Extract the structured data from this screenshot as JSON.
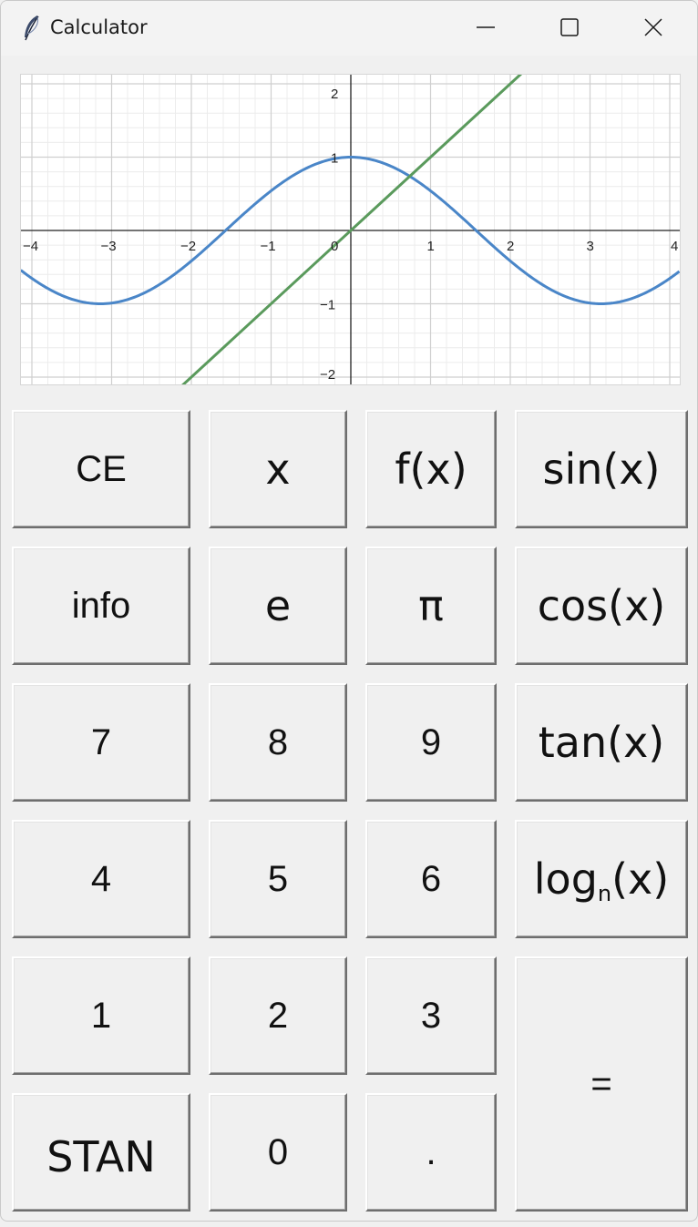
{
  "window": {
    "title": "Calculator",
    "icon": "feather-icon",
    "controls": [
      "minimize-icon",
      "maximize-icon",
      "close-icon"
    ]
  },
  "plot": {
    "x_ticks": [
      "−4",
      "−3",
      "−2",
      "−1",
      "0",
      "1",
      "2",
      "3",
      "4"
    ],
    "y_ticks": [
      "2",
      "1",
      "−1",
      "−2"
    ],
    "colors": {
      "cos": "#4a86c8",
      "line": "#5a9a5c",
      "grid_major": "#cfcfcf",
      "grid_minor": "#ececec",
      "axis": "#222222"
    }
  },
  "buttons": {
    "ce": "CE",
    "x": "x",
    "fx": "f(x)",
    "sin": "sin(x)",
    "info": "info",
    "e": "e",
    "pi": "π",
    "cos": "cos(x)",
    "seven": "7",
    "eight": "8",
    "nine": "9",
    "tan": "tan(x)",
    "four": "4",
    "five": "5",
    "six": "6",
    "log_prefix": "log",
    "log_sub": "n",
    "log_suffix": "(x)",
    "one": "1",
    "two": "2",
    "three": "3",
    "equals": "=",
    "stan": "STAN",
    "zero": "0",
    "dot": "."
  }
}
